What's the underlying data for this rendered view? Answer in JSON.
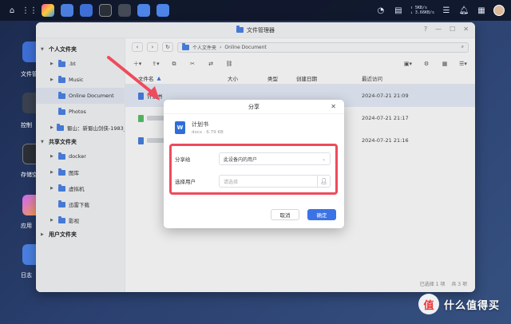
{
  "taskbar": {
    "net_up": "↑ 5KB/s",
    "net_down": "↓ 3.66KB/s",
    "cpu": "CPU",
    "ram": "RAM"
  },
  "desktop": {
    "items": [
      {
        "label": "文件管"
      },
      {
        "label": "控制"
      },
      {
        "label": "存储空"
      },
      {
        "label": "应用"
      },
      {
        "label": "日志"
      }
    ]
  },
  "window": {
    "title": "文件管理器",
    "ctrl_help": "?",
    "ctrl_min": "—",
    "ctrl_max": "☐",
    "ctrl_close": "✕"
  },
  "sidebar": {
    "personal_header": "个人文件夹",
    "personal_items": [
      {
        "label": ".bt"
      },
      {
        "label": "Music"
      },
      {
        "label": "Online Document"
      },
      {
        "label": "Photos"
      },
      {
        "label": "蜀山：新蜀山剑侠-1983_蓝"
      }
    ],
    "shared_header": "共享文件夹",
    "shared_items": [
      {
        "label": "docker"
      },
      {
        "label": "图库"
      },
      {
        "label": "虚拟机"
      },
      {
        "label": "迅雷下载"
      },
      {
        "label": "影视"
      }
    ],
    "users_header": "用户文件夹"
  },
  "path": {
    "root": "个人文件夹",
    "sep": "›",
    "current": "Online Document"
  },
  "table": {
    "headers": {
      "name": "文件名",
      "size": "大小",
      "type": "类型",
      "created": "创建日期",
      "accessed": "最近访问"
    },
    "rows": [
      {
        "name": "计划书",
        "accessed": "2024-07-21 21:09"
      },
      {
        "name": "",
        "accessed": "2024-07-21 21:17"
      },
      {
        "name": "",
        "accessed": "2024-07-21 21:16"
      }
    ]
  },
  "status": {
    "selected": "已选择 1 项",
    "total": "共 3 项"
  },
  "dialog": {
    "title": "分享",
    "file_name": "计划书",
    "file_meta": "docx · 6.79 KB",
    "share_to_label": "分享给",
    "share_to_value": "此设备内的用户",
    "select_user_label": "选择用户",
    "select_user_placeholder": "请选择",
    "cancel": "取消",
    "ok": "确定",
    "close": "✕"
  },
  "watermark": {
    "badge": "值",
    "text": "什么值得买"
  },
  "colors": {
    "accent": "#3b73e6",
    "highlight": "#ee4b5c",
    "folder": "#4d84e8"
  }
}
